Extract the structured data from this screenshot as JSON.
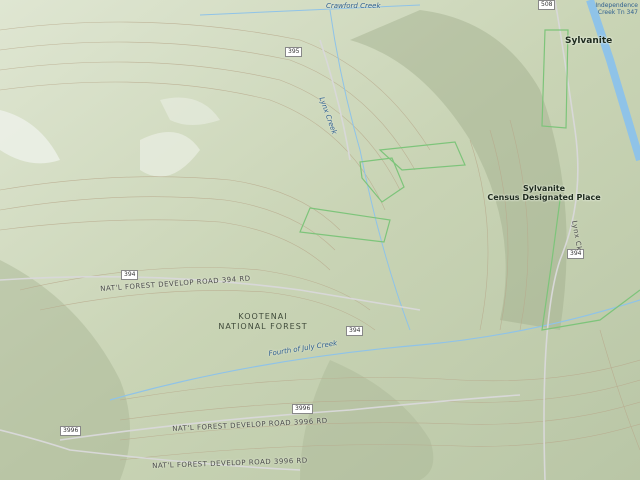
{
  "places": {
    "sylvanite": "Sylvanite",
    "sylvanite_cdp_line1": "Sylvanite",
    "sylvanite_cdp_line2": "Census Designated Place",
    "kootenai_line1": "KOOTENAI",
    "kootenai_line2": "NATIONAL FOREST",
    "independence_line1": "Independence",
    "independence_line2": "Creek Tn 347"
  },
  "water": {
    "crawford_creek": "Crawford Creek",
    "fourth_of_july_creek": "Fourth of July Creek",
    "lynx_creek": "Lynx Creek"
  },
  "roads": {
    "road_394_upper": "NAT'L FOREST DEVELOP ROAD 394 RD",
    "road_3996_middle": "NAT'L FOREST DEVELOP ROAD 3996 RD",
    "road_3996_lower": "NAT'L FOREST DEVELOP ROAD 3996 RD",
    "lynx_road": "Lynx Ck"
  },
  "shields": {
    "s508": "508",
    "s395": "395",
    "s394_left": "394",
    "s394_center": "394",
    "s394_right": "394",
    "s3996_center": "3996",
    "s3996_left": "3996"
  },
  "colors": {
    "terrain": "#cfd9bf",
    "river": "#8fc3e8",
    "boundary": "#7dc47a",
    "contour": "#b8a98c"
  }
}
